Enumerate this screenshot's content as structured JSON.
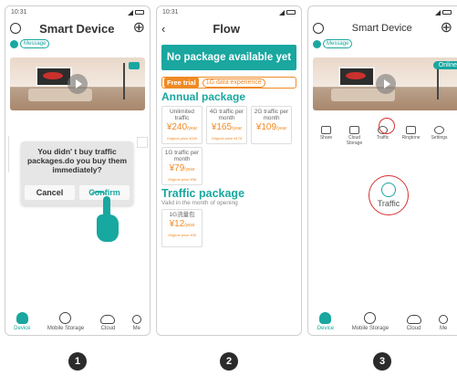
{
  "steps": [
    "1",
    "2",
    "3"
  ],
  "phone1": {
    "time": "10:31",
    "title": "Smart Device",
    "message_pill": "Message",
    "dialog_text": "You didn' t buy traffic packages.do you buy them immediately?",
    "cancel": "Cancel",
    "confirm": "Confirm",
    "nav": [
      "Device",
      "Mobile Storage",
      "Cloud",
      "Me"
    ]
  },
  "phone2": {
    "time": "10:31",
    "title": "Flow",
    "banner": "No package available yet",
    "free_trial": "Free trial",
    "trial_tag": "1G data experience",
    "annual_title": "Annual package",
    "annual_cards": [
      {
        "name": "Unlimited traffic",
        "price": "240",
        "unit": "/year",
        "orig": "Original price ¥240"
      },
      {
        "name": "4G traffic per month",
        "price": "165",
        "unit": "/year",
        "orig": "Original price ¥175"
      },
      {
        "name": "2G traffic per month",
        "price": "109",
        "unit": "/year",
        "orig": ""
      },
      {
        "name": "1G traffic per month",
        "price": "79",
        "unit": "/year",
        "orig": "Original price ¥96"
      }
    ],
    "traffic_title": "Traffic package",
    "traffic_sub": "Valid in the month of opening",
    "traffic_cards": [
      {
        "name": "1G流量包",
        "price": "12",
        "unit": "/year",
        "orig": "Original price ¥30"
      }
    ]
  },
  "phone3": {
    "title": "Smart Device",
    "message_pill": "Message",
    "online": "Online",
    "icons": [
      "Share",
      "Cloud Storage",
      "Traffic",
      "Ringtone",
      "Settings"
    ],
    "traffic_label": "Traffic",
    "nav": [
      "Device",
      "Mobile Storage",
      "Cloud",
      "Me"
    ]
  }
}
